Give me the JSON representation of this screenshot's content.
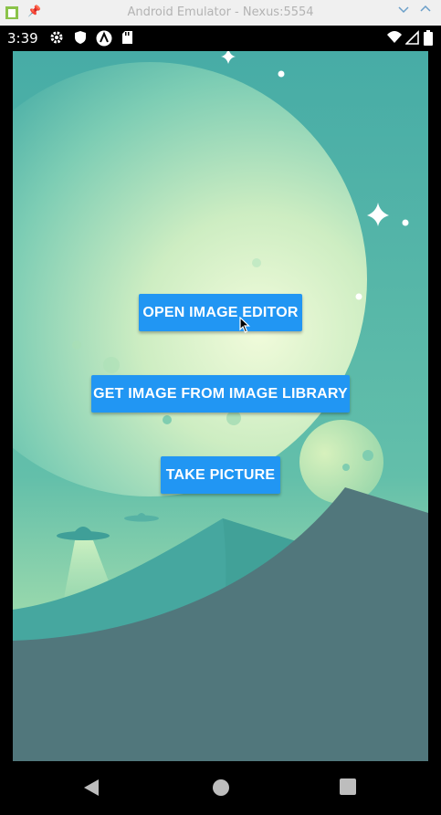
{
  "window": {
    "title": "Android Emulator - Nexus:5554",
    "app_icon": "android-icon",
    "pin_icon": "pin-icon",
    "controls": [
      "chevron-down-icon",
      "chevron-up-icon"
    ]
  },
  "status_bar": {
    "time": "3:39",
    "left_icons": [
      "settings-icon",
      "shield-icon",
      "a-icon",
      "sd-card-icon"
    ],
    "right_icons": [
      "wifi-icon",
      "signal-icon",
      "battery-icon"
    ]
  },
  "main": {
    "buttons": {
      "open_editor": "OPEN IMAGE EDITOR",
      "get_library": "GET IMAGE FROM IMAGE LIBRARY",
      "take_picture": "TAKE PICTURE"
    },
    "background": "space-landscape-illustration",
    "button_color": "#2196f3"
  },
  "nav_bar": {
    "back": "back-icon",
    "home": "home-icon",
    "recents": "recents-icon"
  }
}
